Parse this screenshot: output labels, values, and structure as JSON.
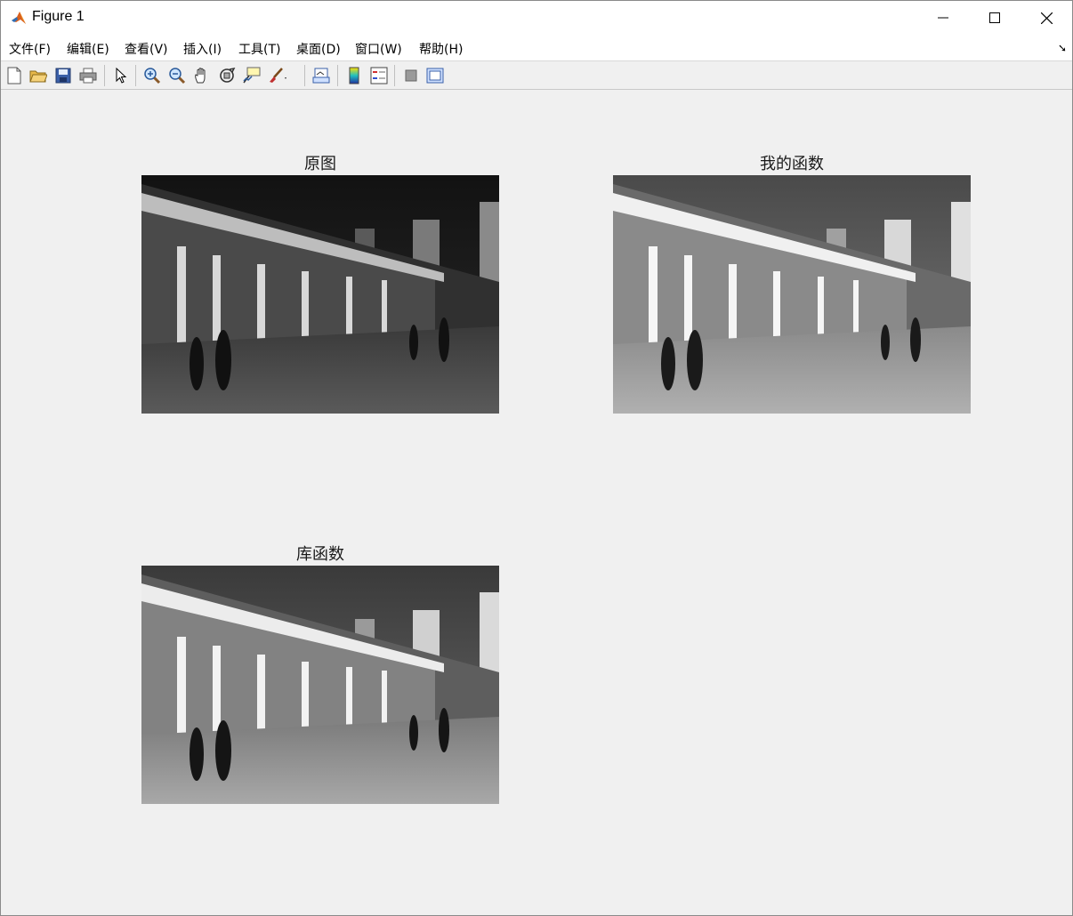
{
  "window": {
    "title": "Figure 1"
  },
  "menu": [
    {
      "label": "文件(F)",
      "icon": "none"
    },
    {
      "label": "编辑(E)"
    },
    {
      "label": "查看(V)"
    },
    {
      "label": "插入(I)"
    },
    {
      "label": "工具(T)"
    },
    {
      "label": "桌面(D)"
    },
    {
      "label": "窗口(W)"
    },
    {
      "label": "帮助(H)"
    }
  ],
  "toolbar": {
    "icons": [
      "new-figure-icon",
      "open-file-icon",
      "save-icon",
      "print-icon",
      "select-arrow-icon",
      "zoom-in-icon",
      "zoom-out-icon",
      "pan-hand-icon",
      "rotate-3d-icon",
      "data-cursor-icon",
      "brush-icon",
      "link-plot-icon",
      "colorbar-icon",
      "legend-icon",
      "hide-plot-tools-icon",
      "show-plot-tools-icon"
    ]
  },
  "subplots": [
    {
      "title": "原图",
      "variant": "original"
    },
    {
      "title": "我的函数",
      "variant": "my-function"
    },
    {
      "title": "库函数",
      "variant": "library-function"
    }
  ],
  "colors": {
    "background": "#f0f0f0",
    "titlebar": "#ffffff"
  }
}
